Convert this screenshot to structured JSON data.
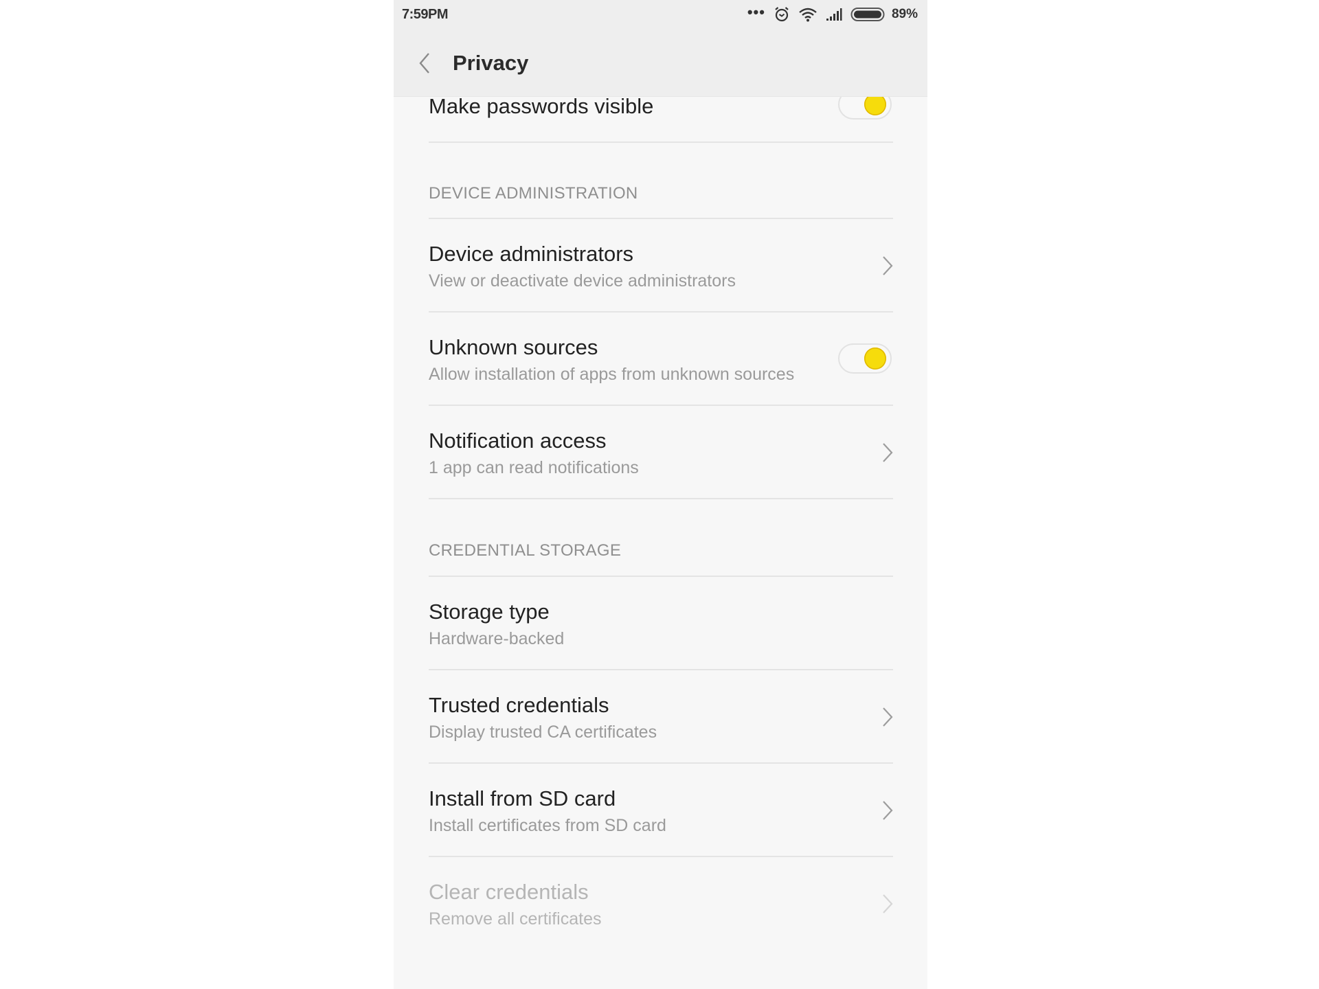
{
  "status_bar": {
    "time": "7:59PM",
    "more_indicator": "•••",
    "icons": [
      "more-dots-icon",
      "alarm-icon",
      "wifi-icon",
      "signal-icon",
      "battery-icon"
    ],
    "battery_percent": "89%"
  },
  "header": {
    "back_icon": "chevron-left-icon",
    "title": "Privacy"
  },
  "settings": {
    "make_passwords_visible": {
      "title": "Make passwords visible",
      "toggle_on": true
    },
    "device_admin_section": "DEVICE ADMINISTRATION",
    "device_administrators": {
      "title": "Device administrators",
      "subtitle": "View or deactivate device administrators"
    },
    "unknown_sources": {
      "title": "Unknown sources",
      "subtitle": "Allow installation of apps from unknown sources",
      "toggle_on": true
    },
    "notification_access": {
      "title": "Notification access",
      "subtitle": "1 app can read notifications"
    },
    "credential_section": "CREDENTIAL STORAGE",
    "storage_type": {
      "title": "Storage type",
      "subtitle": "Hardware-backed"
    },
    "trusted_credentials": {
      "title": "Trusted credentials",
      "subtitle": "Display trusted CA certificates"
    },
    "install_from_sd": {
      "title": "Install from SD card",
      "subtitle": "Install certificates from SD card"
    },
    "clear_credentials": {
      "title": "Clear credentials",
      "subtitle": "Remove all certificates",
      "disabled": true
    }
  },
  "colors": {
    "toggle_accent": "#f6dc0c",
    "header_bg": "#eeeeee",
    "content_bg": "#f7f7f7"
  }
}
